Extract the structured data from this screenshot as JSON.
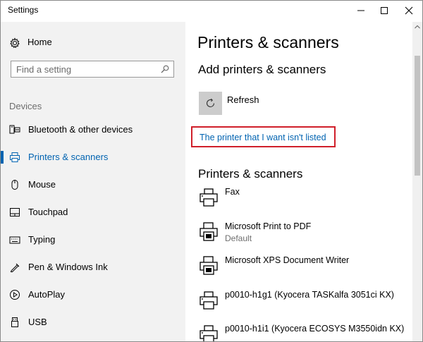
{
  "window": {
    "title": "Settings"
  },
  "sidebar": {
    "home_label": "Home",
    "search_placeholder": "Find a setting",
    "section_label": "Devices",
    "items": [
      {
        "label": "Bluetooth & other devices",
        "icon": "bluetooth-devices-icon"
      },
      {
        "label": "Printers & scanners",
        "icon": "printer-icon",
        "active": true
      },
      {
        "label": "Mouse",
        "icon": "mouse-icon"
      },
      {
        "label": "Touchpad",
        "icon": "touchpad-icon"
      },
      {
        "label": "Typing",
        "icon": "keyboard-icon"
      },
      {
        "label": "Pen & Windows Ink",
        "icon": "pen-icon"
      },
      {
        "label": "AutoPlay",
        "icon": "autoplay-icon"
      },
      {
        "label": "USB",
        "icon": "usb-icon"
      }
    ]
  },
  "main": {
    "title": "Printers & scanners",
    "add_heading": "Add printers & scanners",
    "refresh_label": "Refresh",
    "not_listed_link": "The printer that I want isn't listed",
    "list_heading": "Printers & scanners",
    "printers": [
      {
        "name": "Fax",
        "status": ""
      },
      {
        "name": "Microsoft Print to PDF",
        "status": "Default"
      },
      {
        "name": "Microsoft XPS Document Writer",
        "status": ""
      },
      {
        "name": "p0010-h1g1 (Kyocera TASKalfa 3051ci KX)",
        "status": ""
      },
      {
        "name": "p0010-h1i1 (Kyocera ECOSYS M3550idn KX)",
        "status": ""
      }
    ]
  },
  "colors": {
    "accent": "#0063b1",
    "highlight_box": "#d01f2a",
    "sidebar_bg": "#f2f2f2"
  }
}
